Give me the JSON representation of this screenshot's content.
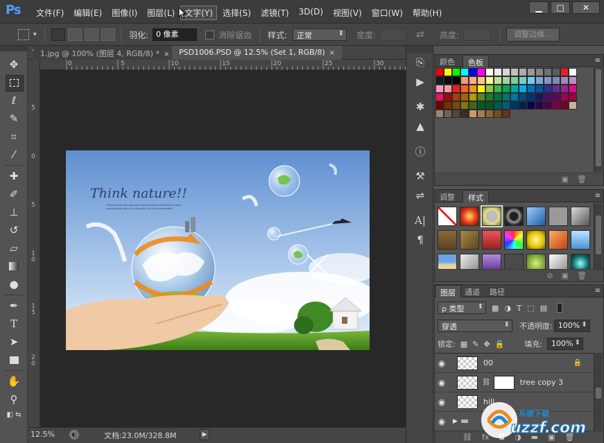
{
  "app": {
    "logo": "Ps"
  },
  "menu": {
    "items": [
      "文件(F)",
      "编辑(E)",
      "图像(I)",
      "图层(L)",
      "文字(Y)",
      "选择(S)",
      "滤镜(T)",
      "3D(D)",
      "视图(V)",
      "窗口(W)",
      "帮助(H)"
    ],
    "active_index": 4
  },
  "window_controls": {
    "minimize": "▁",
    "maximize": "□",
    "close": "✕"
  },
  "options": {
    "feather_label": "羽化:",
    "feather_value": "0 像素",
    "antialias_label": "消除锯齿",
    "style_label": "样式:",
    "style_value": "正常",
    "width_label": "宽度:",
    "height_label": "高度:",
    "refine_edge": "调整边缘..."
  },
  "documents": {
    "tabs": [
      {
        "title": "1.jpg @ 100% (图层 4, RGB/8) *",
        "close": "×",
        "active": false
      },
      {
        "title": "PSD1006.PSD @ 12.5% (Set 1, RGB/8)",
        "close": "×",
        "active": true
      }
    ]
  },
  "rulers": {
    "horizontal": [
      "0",
      "5",
      "10",
      "15",
      "20",
      "25",
      "30"
    ],
    "vertical": [
      "5",
      "0",
      "5",
      "1\n0",
      "1\n5",
      "2\n0"
    ]
  },
  "status": {
    "zoom": "12.5%",
    "doc_info": "文档:23.0M/328.8M",
    "arrow": "▶"
  },
  "artwork": {
    "headline": "Think nature!!",
    "tagline_1": "Green leaves and pollution environments related to an easy",
    "tagline_2": "conservation with the production of the environment."
  },
  "swatches_panel": {
    "tabs": [
      "颜色",
      "色板"
    ],
    "active_tab": 1,
    "menu_icon": "≡",
    "rows": [
      [
        "#ff0000",
        "#ffff00",
        "#00ff00",
        "#00ffff",
        "#0000ff",
        "#ff00ff",
        "#ffffff",
        "#ebebeb",
        "#d6d6d6",
        "#c2c2c2",
        "#adadad",
        "#999999",
        "#858585",
        "#707070",
        "#5c5c5c",
        "#ee1c24",
        "#ffffff"
      ],
      [
        "#1a1a1a",
        "#0a0a0a",
        "#000000",
        "#f7977a",
        "#f9ad81",
        "#fdc68a",
        "#fff79a",
        "#c4df9b",
        "#a3d39c",
        "#82ca9d",
        "#7bcdc8",
        "#6ecff6",
        "#7ea7d8",
        "#8493ca",
        "#8882be",
        "#a187be",
        "#bc8dbf"
      ],
      [
        "#f49ac2",
        "#f6989d",
        "#ed1c24",
        "#f26522",
        "#f7941d",
        "#fff200",
        "#8dc63f",
        "#39b54a",
        "#00a651",
        "#00a99d",
        "#00aeef",
        "#0072bc",
        "#0054a6",
        "#2e3192",
        "#662d91",
        "#92278f",
        "#ec008c"
      ],
      [
        "#ed145b",
        "#9e0b0f",
        "#a0410d",
        "#a36209",
        "#aba000",
        "#598527",
        "#1a7b30",
        "#007236",
        "#00746b",
        "#0076a3",
        "#004b80",
        "#003471",
        "#1b1464",
        "#440e62",
        "#630460",
        "#9e005d",
        "#9e0039"
      ],
      [
        "#790000",
        "#7b2e00",
        "#7d4900",
        "#827b00",
        "#406618",
        "#005e20",
        "#005826",
        "#005952",
        "#005b7f",
        "#003663",
        "#002157",
        "#0d004c",
        "#32004b",
        "#4b0049",
        "#7b0046",
        "#7a0026",
        "#c7b299"
      ],
      [
        "#998675",
        "#736357",
        "#534741",
        "#37302d",
        "#c69c6d",
        "#a67c52",
        "#8c6239",
        "#754c24",
        "#603913"
      ]
    ]
  },
  "styles_panel": {
    "tabs": [
      "调整",
      "样式"
    ],
    "active_tab": 1,
    "menu_icon": "≡",
    "items": [
      "none-style",
      "red-glow",
      "yellow-frame",
      "dark-ring",
      "blue-gloss",
      "gray-flat",
      "gray-bevel",
      "brown-wood",
      "gold-texture",
      "red-stripe",
      "color-burst",
      "yellow-gem",
      "orange-gradient",
      "sky-blue",
      "beach-photo",
      "glass-cube",
      "purple-gradient",
      "dark-square",
      "green-bevel",
      "white-bevel",
      "teal-glow"
    ]
  },
  "layers_panel": {
    "tabs": [
      "图层",
      "通道",
      "路径"
    ],
    "active_tab": 0,
    "menu_icon": "≡",
    "filter_label": "ρ 类型",
    "blend_mode": "穿透",
    "opacity_label": "不透明度:",
    "opacity_value": "100%",
    "lock_label": "锁定:",
    "fill_label": "填充:",
    "fill_value": "100%",
    "layers": [
      {
        "name": "00",
        "locked": true
      },
      {
        "name": "tree copy 3",
        "mask": true
      },
      {
        "name": "hill"
      },
      {
        "name": "",
        "group": true
      }
    ],
    "footer_icons": [
      "link-icon",
      "fx-icon",
      "mask-icon",
      "adjustment-icon",
      "folder-icon",
      "new-layer-icon",
      "trash-icon"
    ]
  },
  "watermark": {
    "brand": "uzzf.com",
    "cn": "东坡下载"
  },
  "colors": {
    "chrome_dark": "#3c3c3c",
    "panel": "#535353",
    "canvas_bg": "#282828",
    "ps_blue": "#4aa3ff"
  }
}
